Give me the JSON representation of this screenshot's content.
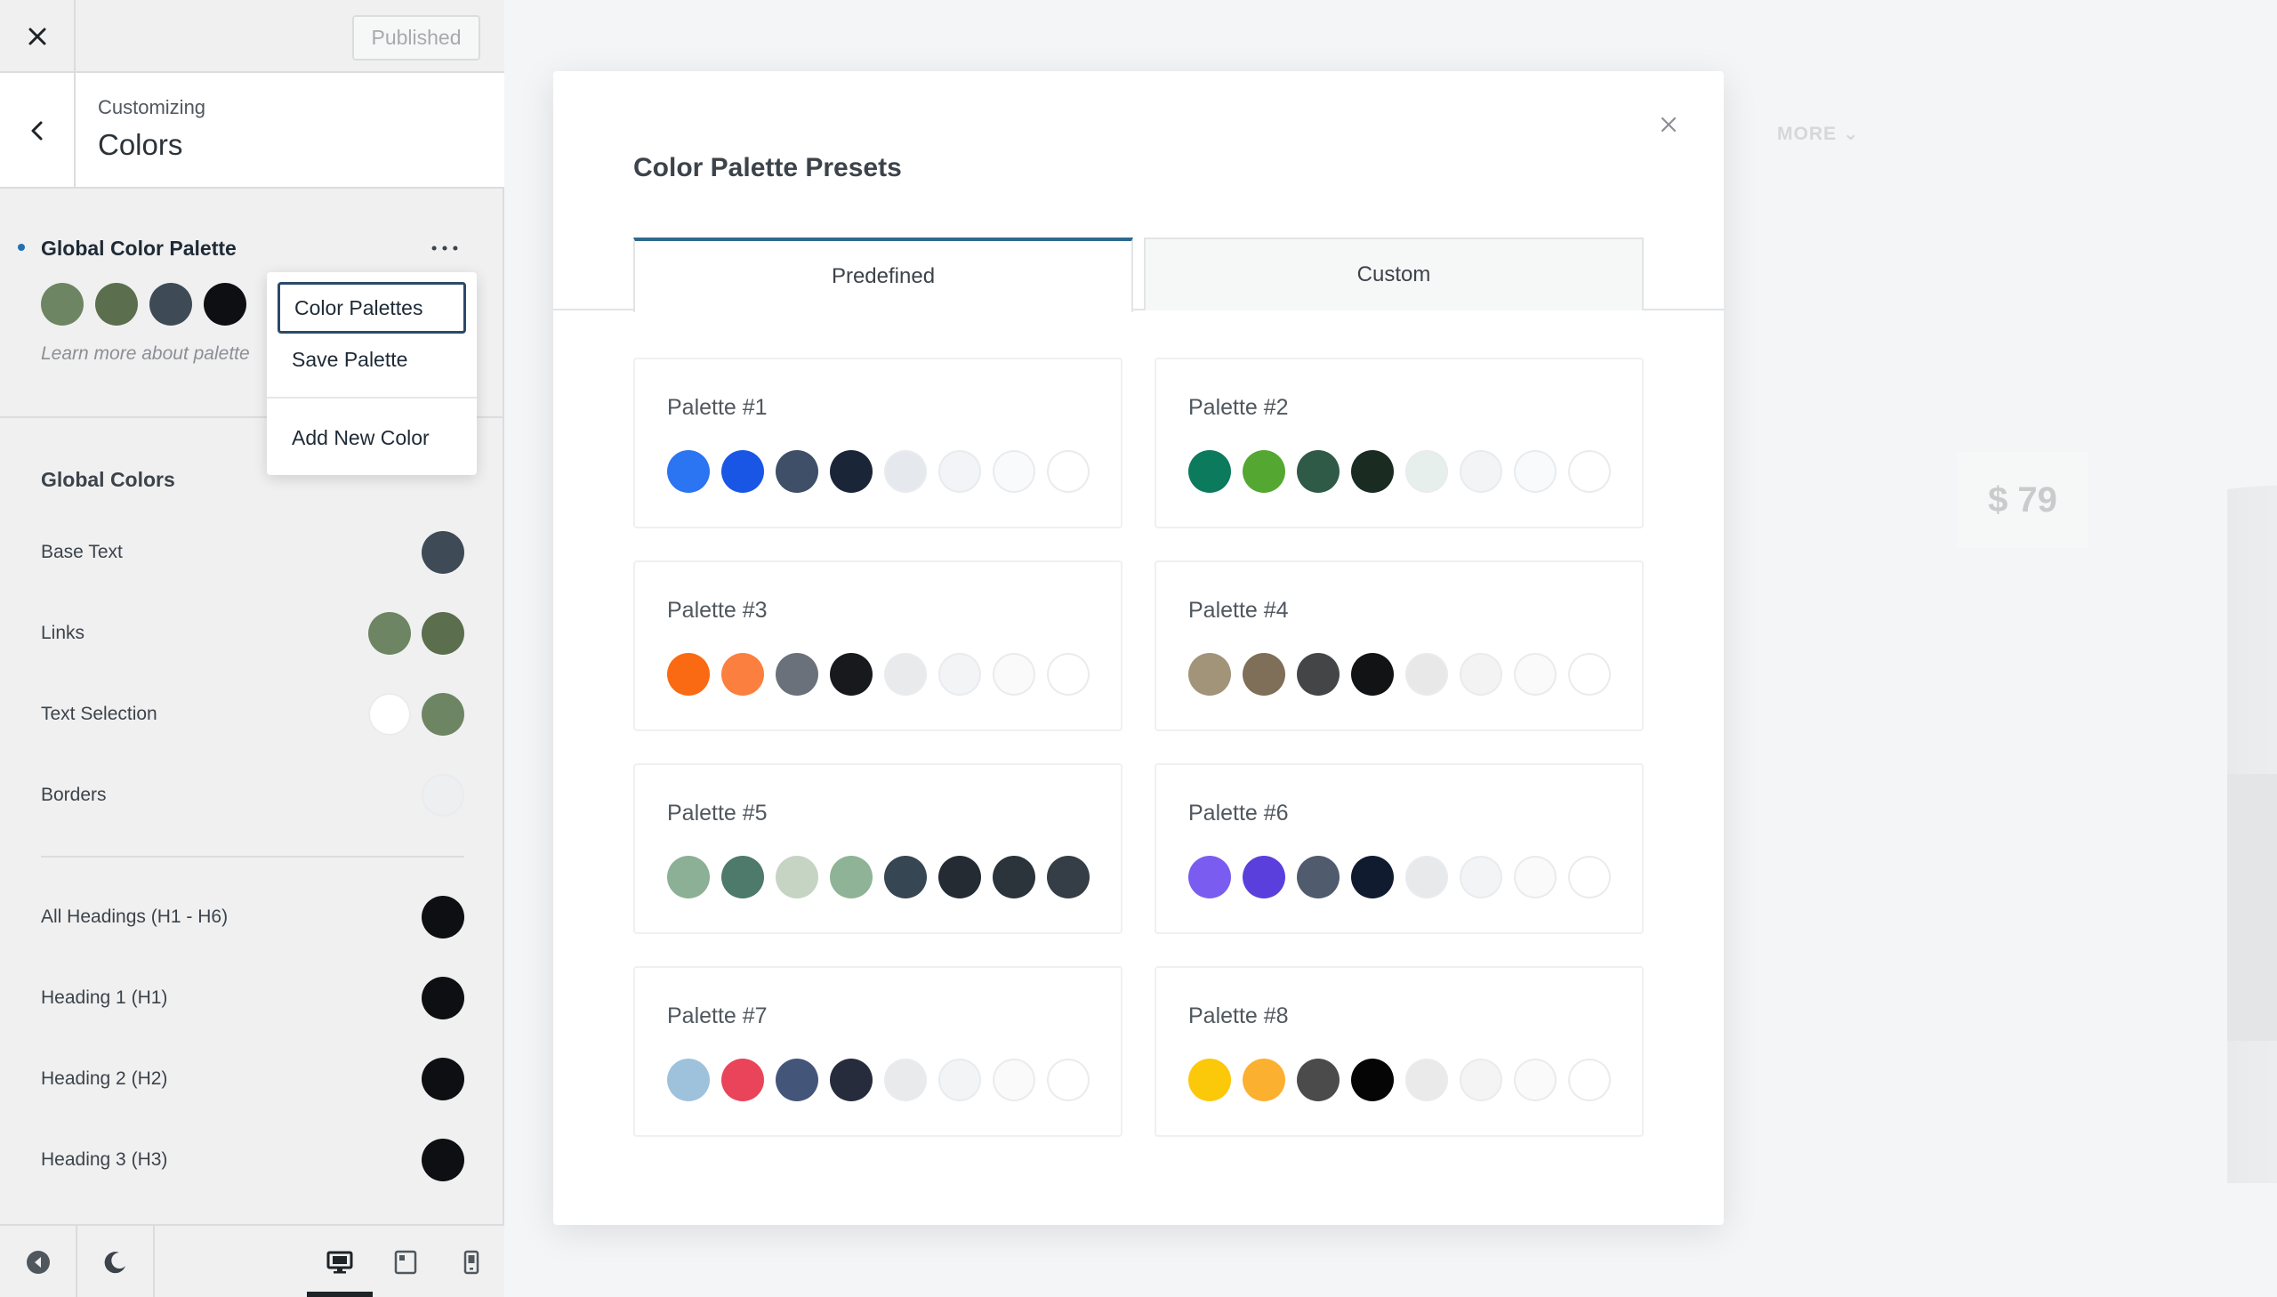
{
  "header": {
    "published_label": "Published"
  },
  "panel": {
    "customizing_label": "Customizing",
    "section_title": "Colors"
  },
  "global_palette": {
    "title": "Global Color Palette",
    "swatches": [
      "#6e8563",
      "#5b6e4e",
      "#3e4a55",
      "#0e0f12"
    ],
    "learn_more": "Learn more about palette"
  },
  "dropdown": {
    "items": [
      {
        "label": "Color Palettes"
      },
      {
        "label": "Save Palette"
      },
      {
        "label": "Add New Color"
      }
    ]
  },
  "global_colors": {
    "title": "Global Colors",
    "rows": [
      {
        "label": "Base Text",
        "colors": [
          "#3e4a55"
        ]
      },
      {
        "label": "Links",
        "colors": [
          "#6e8563",
          "#5b6e4e"
        ]
      },
      {
        "label": "Text Selection",
        "colors": [
          "#ffffff",
          "#6e8563"
        ]
      },
      {
        "label": "Borders",
        "colors": [
          "#eeeff1"
        ]
      },
      {
        "label": "All Headings (H1 - H6)",
        "colors": [
          "#0e0f12"
        ]
      },
      {
        "label": "Heading 1 (H1)",
        "colors": [
          "#0e0f12"
        ]
      },
      {
        "label": "Heading 2 (H2)",
        "colors": [
          "#0e0f12"
        ]
      },
      {
        "label": "Heading 3 (H3)",
        "colors": [
          "#0e0f12"
        ]
      }
    ]
  },
  "preview": {
    "nav_more": "MORE",
    "price": "$ 79"
  },
  "modal": {
    "title": "Color Palette Presets",
    "tabs": [
      {
        "label": "Predefined"
      },
      {
        "label": "Custom"
      }
    ],
    "palettes": [
      {
        "name": "Palette #1",
        "colors": [
          "#2b74f2",
          "#1a56e6",
          "#3e4f67",
          "#1a2638",
          "#e5e8ed",
          "#f3f4f7",
          "#f9fafb",
          "#ffffff"
        ]
      },
      {
        "name": "Palette #2",
        "colors": [
          "#0c7a5c",
          "#54a832",
          "#2f5a48",
          "#1a2b22",
          "#e7efec",
          "#f3f4f5",
          "#f9fafb",
          "#ffffff"
        ]
      },
      {
        "name": "Palette #3",
        "colors": [
          "#fa6a12",
          "#fb7f3f",
          "#6a717b",
          "#17191c",
          "#e9eaec",
          "#f3f4f6",
          "#fafafb",
          "#ffffff"
        ]
      },
      {
        "name": "Palette #4",
        "colors": [
          "#a29479",
          "#7f6e58",
          "#444547",
          "#121314",
          "#e8e8e9",
          "#f3f3f4",
          "#fafafa",
          "#ffffff"
        ]
      },
      {
        "name": "Palette #5",
        "colors": [
          "#8cb095",
          "#4d7a6a",
          "#c6d4c3",
          "#8fb396",
          "#364652",
          "#252b33",
          "#2b333b",
          "#353e46"
        ]
      },
      {
        "name": "Palette #6",
        "colors": [
          "#7a5df0",
          "#5b3fdd",
          "#505b6d",
          "#111b2f",
          "#e8e9eb",
          "#f3f4f5",
          "#fafafb",
          "#ffffff"
        ]
      },
      {
        "name": "Palette #7",
        "colors": [
          "#9ec2dc",
          "#e9445a",
          "#44557a",
          "#262c3c",
          "#e9eaec",
          "#f3f4f6",
          "#fafafb",
          "#ffffff"
        ]
      },
      {
        "name": "Palette #8",
        "colors": [
          "#fcc80a",
          "#fcb030",
          "#4b4b4c",
          "#050505",
          "#eaeaea",
          "#f4f4f5",
          "#fafafb",
          "#ffffff"
        ]
      }
    ]
  }
}
